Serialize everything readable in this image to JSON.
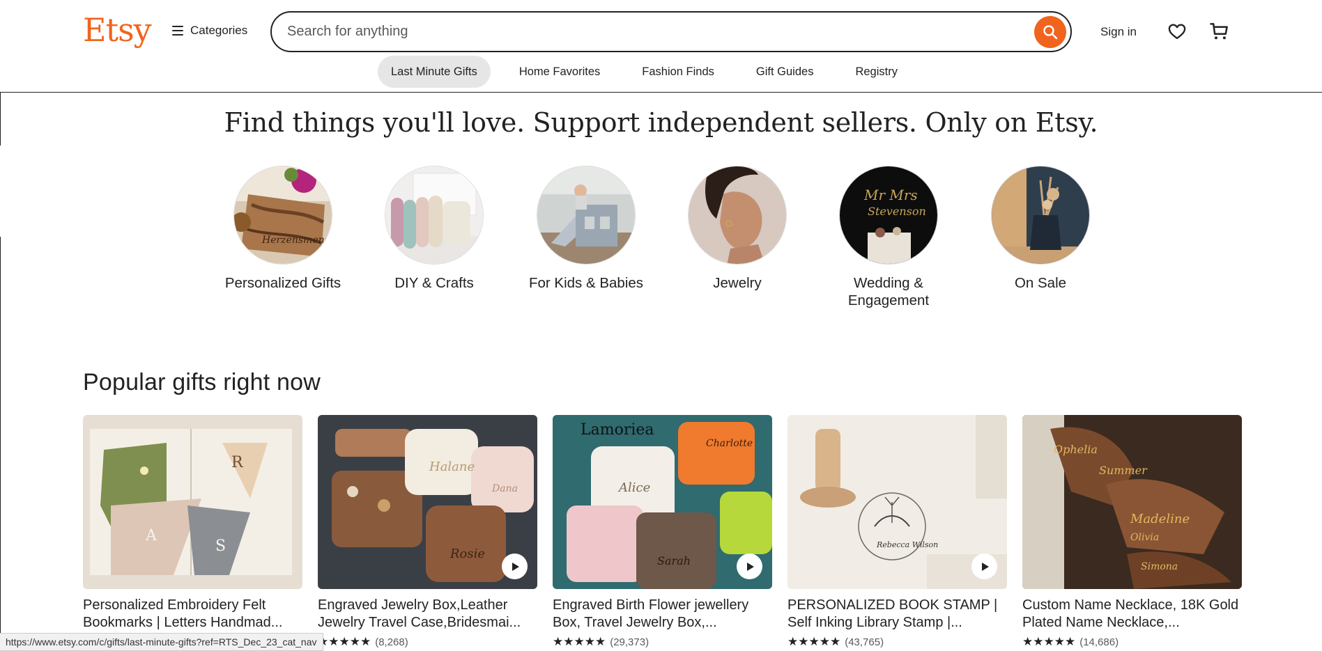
{
  "header": {
    "logo": "Etsy",
    "categories_label": "Categories",
    "search_placeholder": "Search for anything",
    "sign_in": "Sign in"
  },
  "subnav": [
    {
      "label": "Last Minute Gifts",
      "active": true
    },
    {
      "label": "Home Favorites"
    },
    {
      "label": "Fashion Finds"
    },
    {
      "label": "Gift Guides"
    },
    {
      "label": "Registry"
    }
  ],
  "hero": {
    "headline": "Find things you'll love. Support independent sellers. Only on Etsy."
  },
  "categories": [
    {
      "label": "Personalized Gifts"
    },
    {
      "label": "DIY & Crafts"
    },
    {
      "label": "For Kids & Babies"
    },
    {
      "label": "Jewelry"
    },
    {
      "label": "Wedding & Engagement"
    },
    {
      "label": "On Sale"
    }
  ],
  "popular": {
    "heading": "Popular gifts right now",
    "items": [
      {
        "title": "Personalized Embroidery Felt Bookmarks | Letters Handmad...",
        "stars": "★★★★★",
        "reviews": "",
        "video": false
      },
      {
        "title": "Engraved Jewelry Box,Leather Jewelry Travel Case,Bridesmai...",
        "stars": "★★★★★",
        "reviews": "(8,268)",
        "video": true
      },
      {
        "title": "Engraved Birth Flower jewellery Box, Travel Jewelry Box,...",
        "stars": "★★★★★",
        "reviews": "(29,373)",
        "video": true
      },
      {
        "title": "PERSONALIZED BOOK STAMP | Self Inking Library Stamp |...",
        "stars": "★★★★★",
        "reviews": "(43,765)",
        "video": true
      },
      {
        "title": "Custom Name Necklace, 18K Gold Plated Name Necklace,...",
        "stars": "★★★★★",
        "reviews": "(14,686)",
        "video": false
      }
    ]
  },
  "status_url": "https://www.etsy.com/c/gifts/last-minute-gifts?ref=RTS_Dec_23_cat_nav",
  "colors": {
    "brand": "#f1641e"
  },
  "icons": [
    "hamburger-icon",
    "search-icon",
    "heart-icon",
    "cart-icon",
    "play-icon",
    "star-icon"
  ]
}
